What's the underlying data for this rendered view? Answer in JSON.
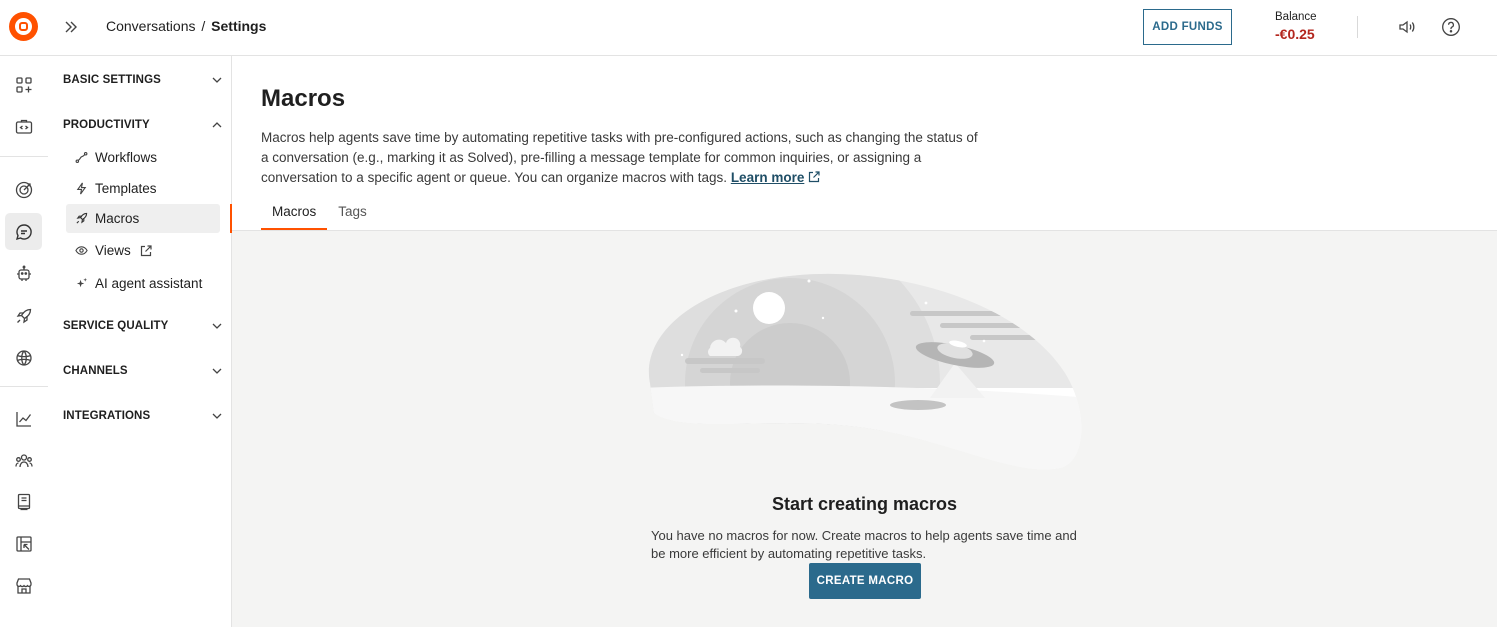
{
  "header": {
    "breadcrumb_parent": "Conversations",
    "breadcrumb_separator": "/",
    "breadcrumb_current": "Settings",
    "add_funds_label": "ADD FUNDS",
    "balance_label": "Balance",
    "balance_value": "-€0.25",
    "icons": [
      "logo",
      "expand-icon",
      "speaker-icon",
      "help-icon"
    ]
  },
  "rail": {
    "icons": [
      "apps-add-icon",
      "developer-icon",
      "target-icon",
      "chat-icon",
      "bot-icon",
      "rocket-icon",
      "ai-icon",
      "analytics-icon",
      "contacts-icon",
      "notebook-icon",
      "reports-icon",
      "store-icon"
    ],
    "active": "chat-icon"
  },
  "nav": {
    "sections": [
      {
        "label": "BASIC SETTINGS",
        "expanded": false
      },
      {
        "label": "PRODUCTIVITY",
        "expanded": true
      },
      {
        "label": "SERVICE QUALITY",
        "expanded": false
      },
      {
        "label": "CHANNELS",
        "expanded": false
      },
      {
        "label": "INTEGRATIONS",
        "expanded": false
      }
    ],
    "items": [
      {
        "label": "Workflows",
        "icon": "workflow-icon"
      },
      {
        "label": "Templates",
        "icon": "lightning-icon"
      },
      {
        "label": "Macros",
        "icon": "rocket-icon",
        "active": true
      },
      {
        "label": "Views",
        "icon": "eye-icon"
      },
      {
        "label": "AI agent assistant",
        "icon": "sparkle-icon"
      }
    ]
  },
  "main": {
    "title": "Macros",
    "description": "Macros help agents save time by automating repetitive tasks with pre-configured actions, such as changing the status of a conversation (e.g., marking it as Solved), pre-filling a message template for common inquiries, or assigning a conversation to a specific agent or queue. You can organize macros with tags.",
    "learn_more": "Learn more",
    "tabs": [
      {
        "label": "Macros",
        "active": true
      },
      {
        "label": "Tags",
        "active": false
      }
    ],
    "empty_state": {
      "title": "Start creating macros",
      "description": "You have no macros for now. Create macros to help agents save time and be more efficient by automating repetitive tasks.",
      "button_label": "CREATE MACRO"
    }
  },
  "colors": {
    "accent": "#ff5100",
    "primary_button": "#2b6a8c",
    "balance_negative": "#b3261e",
    "content_background": "#f4f4f3"
  }
}
